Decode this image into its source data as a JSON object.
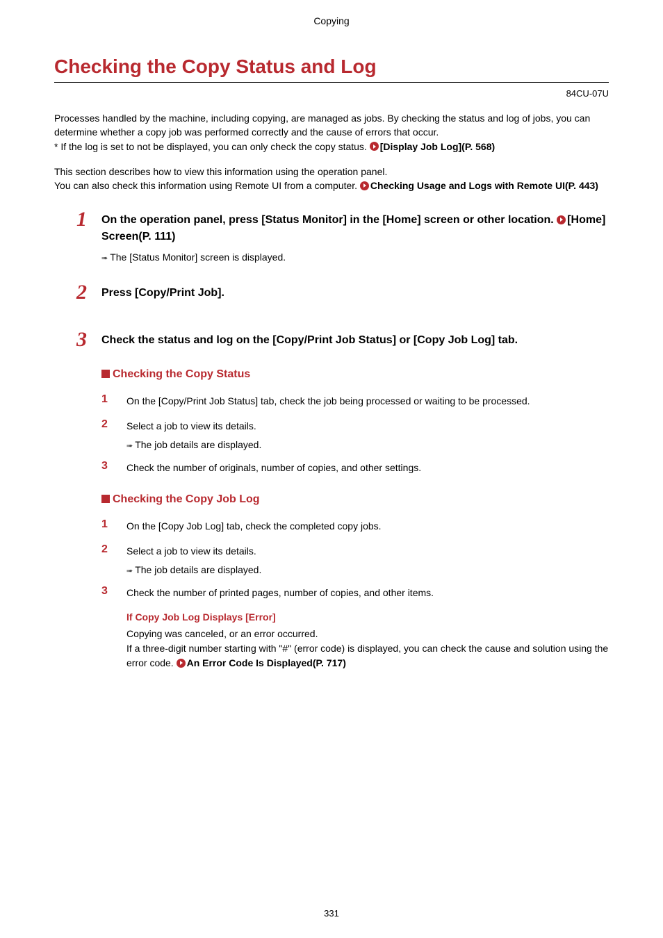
{
  "header": {
    "section_name": "Copying"
  },
  "title": "Checking the Copy Status and Log",
  "doc_code": "84CU-07U",
  "intro1": {
    "line1": "Processes handled by the machine, including copying, are managed as jobs. By checking the status and log of jobs, you can determine whether a copy job was performed correctly and the cause of errors that occur.",
    "line2_prefix": "* If the log is set to not be displayed, you can only check the copy status. ",
    "line2_link": "[Display Job Log](P. 568)"
  },
  "intro2": {
    "line1": "This section describes how to view this information using the operation panel.",
    "line2_prefix": "You can also check this information using Remote UI from a computer. ",
    "line2_link": "Checking Usage and Logs with Remote UI(P. 443)"
  },
  "steps": {
    "s1": {
      "num": "1",
      "text_prefix": "On the operation panel, press [Status Monitor] in the [Home] screen or other location. ",
      "text_link": "[Home] Screen(P. 111)",
      "result": "The [Status Monitor] screen is displayed."
    },
    "s2": {
      "num": "2",
      "text": "Press [Copy/Print Job]."
    },
    "s3": {
      "num": "3",
      "text": "Check the status and log on the [Copy/Print Job Status] or [Copy Job Log] tab."
    }
  },
  "sub1": {
    "heading": "Checking the Copy Status",
    "steps": {
      "a": {
        "num": "1",
        "text": "On the [Copy/Print Job Status] tab, check the job being processed or waiting to be processed."
      },
      "b": {
        "num": "2",
        "text": "Select a job to view its details.",
        "result": "The job details are displayed."
      },
      "c": {
        "num": "3",
        "text": "Check the number of originals, number of copies, and other settings."
      }
    }
  },
  "sub2": {
    "heading": "Checking the Copy Job Log",
    "steps": {
      "a": {
        "num": "1",
        "text": "On the [Copy Job Log] tab, check the completed copy jobs."
      },
      "b": {
        "num": "2",
        "text": "Select a job to view its details.",
        "result": "The job details are displayed."
      },
      "c": {
        "num": "3",
        "text": "Check the number of printed pages, number of copies, and other items."
      }
    },
    "error": {
      "heading": "If Copy Job Log Displays [Error]",
      "line1": "Copying was canceled, or an error occurred.",
      "line2_prefix": "If a three-digit number starting with \"#\" (error code) is displayed, you can check the cause and solution using the error code. ",
      "line2_link": "An Error Code Is Displayed(P. 717)"
    }
  },
  "page_number": "331"
}
